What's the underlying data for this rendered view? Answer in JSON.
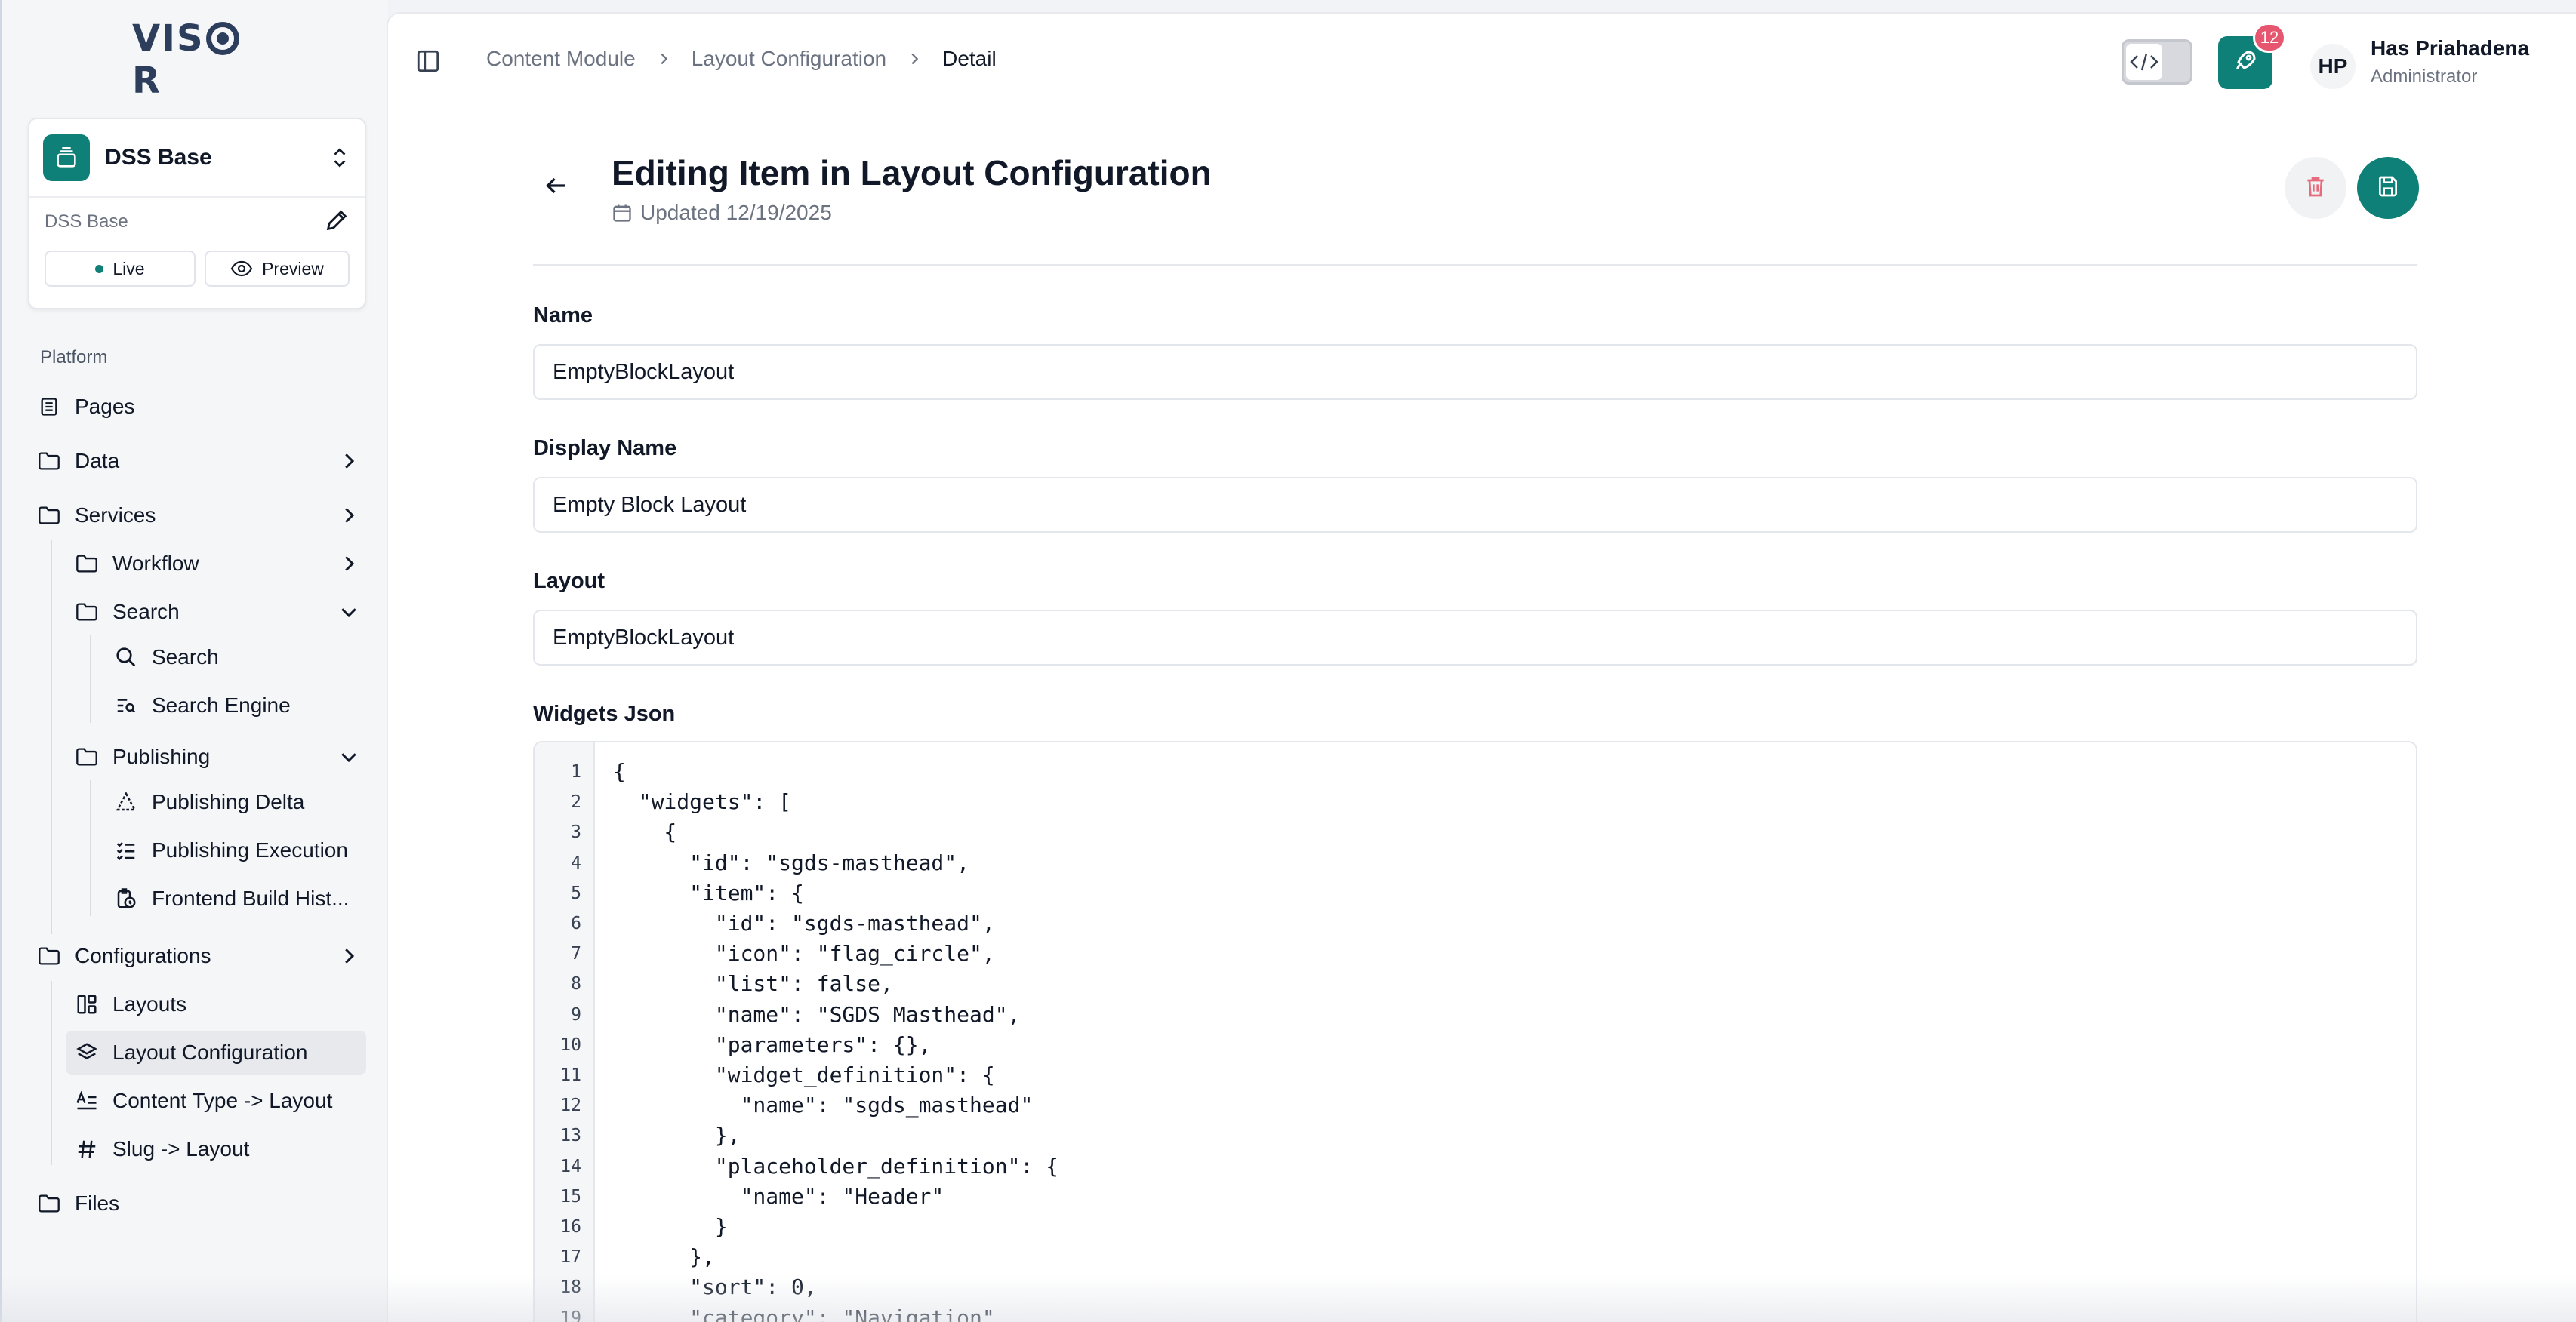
{
  "sidebar": {
    "logo": "VISOR",
    "site": {
      "name": "DSS Base",
      "subtitle": "DSS Base",
      "live_label": "Live",
      "preview_label": "Preview"
    },
    "section_label": "Platform",
    "items": {
      "pages": "Pages",
      "data": "Data",
      "services": "Services",
      "workflow": "Workflow",
      "search_group": "Search",
      "search": "Search",
      "search_engine": "Search Engine",
      "publishing": "Publishing",
      "publishing_delta": "Publishing Delta",
      "publishing_execution": "Publishing Execution",
      "frontend_build": "Frontend Build Hist...",
      "configurations": "Configurations",
      "layouts": "Layouts",
      "layout_configuration": "Layout Configuration",
      "content_type_layout": "Content Type -> Layout",
      "slug_layout": "Slug -> Layout",
      "files": "Files"
    }
  },
  "header": {
    "breadcrumbs": [
      "Content Module",
      "Layout Configuration",
      "Detail"
    ],
    "notifications": "12",
    "user": {
      "initials": "HP",
      "name": "Has Priahadena",
      "role": "Administrator"
    }
  },
  "page": {
    "title": "Editing Item in Layout Configuration",
    "updated": "Updated 12/19/2025"
  },
  "form": {
    "name_label": "Name",
    "name_value": "EmptyBlockLayout",
    "display_name_label": "Display Name",
    "display_name_value": "Empty Block Layout",
    "layout_label": "Layout",
    "layout_value": "EmptyBlockLayout",
    "widgets_label": "Widgets Json",
    "widgets_lines": [
      "{",
      "  \"widgets\": [",
      "    {",
      "      \"id\": \"sgds-masthead\",",
      "      \"item\": {",
      "        \"id\": \"sgds-masthead\",",
      "        \"icon\": \"flag_circle\",",
      "        \"list\": false,",
      "        \"name\": \"SGDS Masthead\",",
      "        \"parameters\": {},",
      "        \"widget_definition\": {",
      "          \"name\": \"sgds_masthead\"",
      "        },",
      "        \"placeholder_definition\": {",
      "          \"name\": \"Header\"",
      "        }",
      "      },",
      "      \"sort\": 0,",
      "      \"category\": \"Navigation\","
    ]
  },
  "colors": {
    "accent": "#0f8078",
    "badge": "#e6566e",
    "danger_icon": "#e66b7d"
  }
}
